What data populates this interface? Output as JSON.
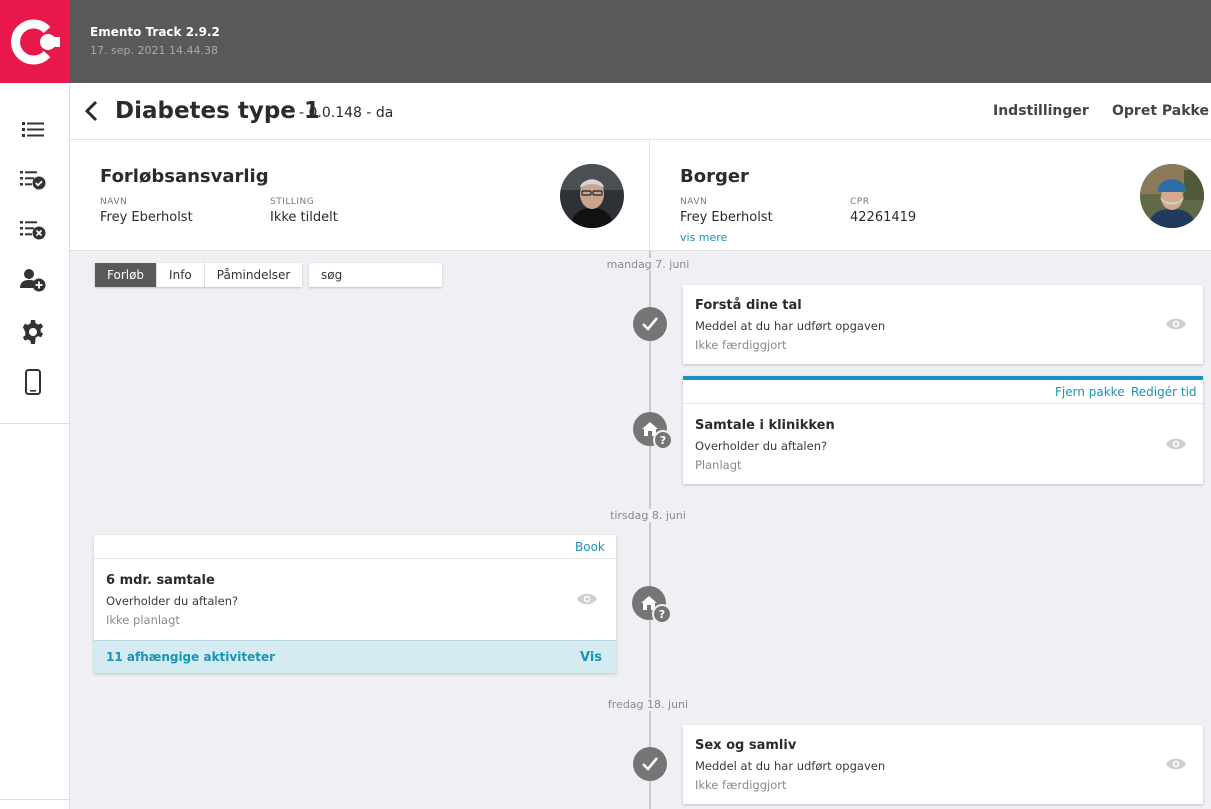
{
  "app": {
    "title": "Emento Track 2.9.2",
    "timestamp": "17. sep. 2021 14.44.38",
    "brand_color": "#e8184a",
    "accent_color": "#1a93b8"
  },
  "rail": {
    "items": [
      {
        "icon": "list-icon"
      },
      {
        "icon": "list-check-icon"
      },
      {
        "icon": "list-remove-icon"
      },
      {
        "icon": "add-person-icon"
      },
      {
        "icon": "settings-gear-icon"
      },
      {
        "icon": "mobile-phone-icon"
      }
    ]
  },
  "header": {
    "title": "Diabetes type 1",
    "version": "- 0.0.148 - da",
    "settings_label": "Indstillinger",
    "create_package_label": "Opret Pakke"
  },
  "responsible": {
    "heading": "Forløbsansvarlig",
    "name_label": "NAVN",
    "name": "Frey Eberholst",
    "position_label": "STILLING",
    "position": "Ikke tildelt"
  },
  "citizen": {
    "heading": "Borger",
    "name_label": "NAVN",
    "name": "Frey Eberholst",
    "cpr_label": "CPR",
    "cpr": "42261419",
    "more_link": "vis mere"
  },
  "tabs": {
    "items": [
      "Forløb",
      "Info",
      "Påmindelser"
    ],
    "active": "Forløb",
    "search_value": "søg"
  },
  "timeline": {
    "dates": [
      "mandag 7. juni",
      "tirsdag 8. juni",
      "fredag 18. juni"
    ],
    "cards": [
      {
        "title": "Forstå dine tal",
        "subtitle": "Meddel at du har udført opgaven",
        "status": "Ikke færdiggjort"
      },
      {
        "title": "Samtale i klinikken",
        "subtitle": "Overholder du aftalen?",
        "status": "Planlagt",
        "remove_label": "Fjern pakke",
        "edit_time_label": "Redigér tid"
      },
      {
        "title": "6 mdr. samtale",
        "subtitle": "Overholder du aftalen?",
        "status": "Ikke planlagt",
        "book_label": "Book",
        "dependent_label": "11 afhængige aktiviteter",
        "show_label": "Vis"
      },
      {
        "title": "Sex og samliv",
        "subtitle": "Meddel at du har udført opgaven",
        "status": "Ikke færdiggjort"
      }
    ],
    "question_mark": "?"
  }
}
